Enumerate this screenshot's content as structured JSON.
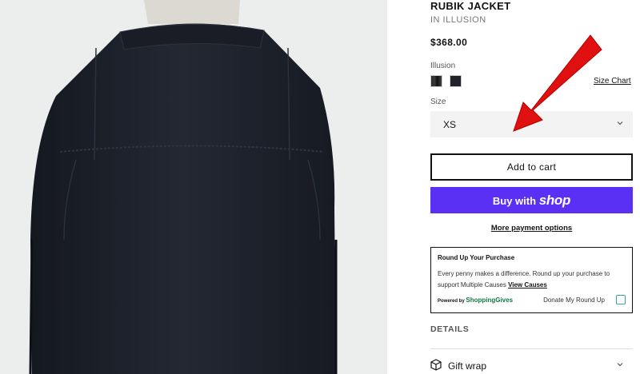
{
  "product": {
    "title": "RUBIK JACKET",
    "subtitle": "IN ILLUSION",
    "price": "$368.00"
  },
  "color": {
    "label": "Illusion",
    "swatches": [
      "illusion-swatch",
      "black-swatch"
    ]
  },
  "size_chart_label": "Size Chart",
  "size": {
    "label": "Size",
    "selected": "XS"
  },
  "buttons": {
    "add_to_cart": "Add to cart",
    "buy_with": "Buy with",
    "shop_word": "shop",
    "more_payment": "More payment options"
  },
  "roundup": {
    "title": "Round Up Your Purchase",
    "description": "Every penny makes a difference. Round up your purchase to support Multiple Causes",
    "view_causes": "View Causes",
    "powered_by": "Powered by",
    "brand": "ShoppingGives",
    "donate_label": "Donate My Round Up"
  },
  "details_heading": "DETAILS",
  "gift_wrap": "Gift wrap",
  "colors": {
    "shop_purple": "#5a31f4",
    "annotation_arrow": "#e01010",
    "jacket": "#1c2029"
  },
  "icons": [
    "chevron-down-icon",
    "gift-box-icon"
  ]
}
